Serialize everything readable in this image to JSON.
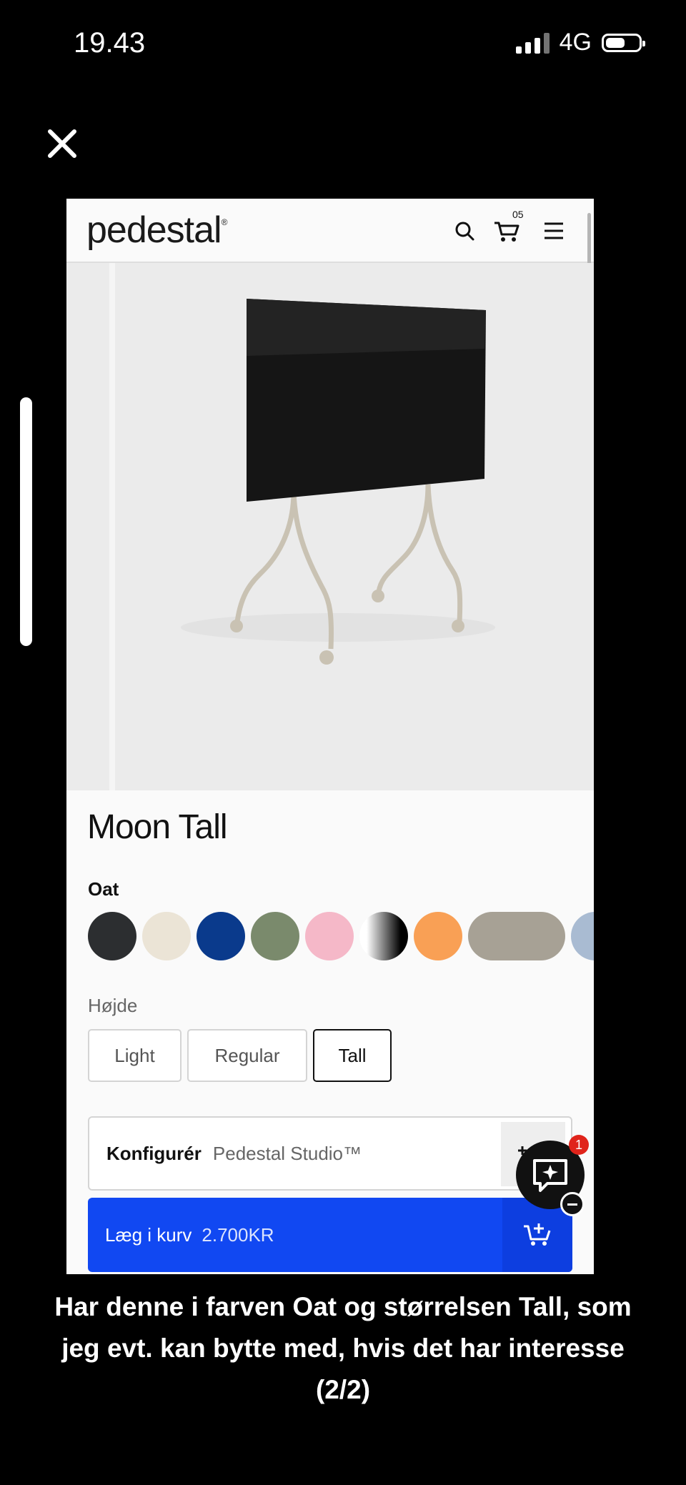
{
  "status_bar": {
    "time": "19.43",
    "network": "4G"
  },
  "site": {
    "logo": "pedestal",
    "logo_mark": "®",
    "cart_count": "05"
  },
  "product": {
    "title": "Moon Tall",
    "selected_color": "Oat",
    "swatch_colors": [
      "#2c2e30",
      "#ebe4d6",
      "#0a3a8c",
      "#7a8a6c",
      "#f5b8c8",
      "gradient-black-white",
      "#f9a055",
      "#a7a195",
      "#a9bbd2"
    ],
    "height_label": "Højde",
    "height_options": [
      "Light",
      "Regular",
      "Tall"
    ],
    "selected_height": "Tall"
  },
  "configure": {
    "label": "Konfigurér",
    "sublabel": "Pedestal Studio™"
  },
  "add_to_cart": {
    "label": "Læg i kurv",
    "price": "2.700KR",
    "accent": "#1148f2"
  },
  "chat": {
    "badge_count": "1"
  },
  "caption": {
    "line1": "Har denne i farven Oat og størrelsen Tall, som",
    "line2": "jeg evt. kan bytte med, hvis det har interesse",
    "line3": "(2/2)"
  }
}
